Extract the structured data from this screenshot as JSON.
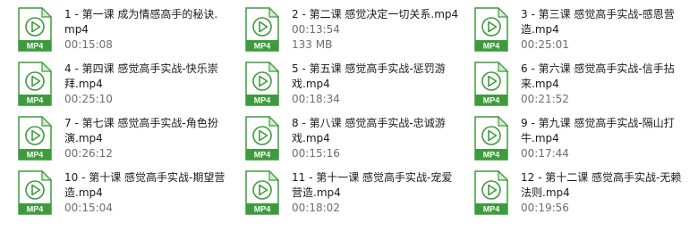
{
  "icon": {
    "name": "mp4-file-icon",
    "badge": "MP4",
    "accent": "#3d9b3d",
    "fill": "#ffffff",
    "fold": "#d7ebd0"
  },
  "files": [
    {
      "line1": "1 - 第一课 成为情感高手的秘诀.",
      "line2": "mp4",
      "meta": "00:15:08"
    },
    {
      "line1": "2 - 第二课 感觉决定一切关系.mp4",
      "line2": "00:13:54",
      "meta": "133 MB"
    },
    {
      "line1": "3 - 第三课 感觉高手实战-感恩营",
      "line2": "造.mp4",
      "meta": "00:25:01"
    },
    {
      "line1": "4 - 第四课 感觉高手实战-快乐崇",
      "line2": "拜.mp4",
      "meta": "00:25:10"
    },
    {
      "line1": "5 - 第五课 感觉高手实战-惩罚游",
      "line2": "戏.mp4",
      "meta": "00:18:34"
    },
    {
      "line1": "6 - 第六课 感觉高手实战-信手拈",
      "line2": "来.mp4",
      "meta": "00:21:52"
    },
    {
      "line1": "7 - 第七课 感觉高手实战-角色扮",
      "line2": "演.mp4",
      "meta": "00:26:12"
    },
    {
      "line1": "8 - 第八课 感觉高手实战-忠诚游",
      "line2": "戏.mp4",
      "meta": "00:15:16"
    },
    {
      "line1": "9 - 第九课 感觉高手实战-隔山打",
      "line2": "牛.mp4",
      "meta": "00:17:44"
    },
    {
      "line1": "10 - 第十课 感觉高手实战-期望营",
      "line2": "造.mp4",
      "meta": "00:15:04"
    },
    {
      "line1": "11 - 第十一课 感觉高手实战-宠爱",
      "line2": "营造.mp4",
      "meta": "00:18:02"
    },
    {
      "line1": "12 - 第十二课 感觉高手实战-无赖",
      "line2": "法则.mp4",
      "meta": "00:19:56"
    }
  ]
}
